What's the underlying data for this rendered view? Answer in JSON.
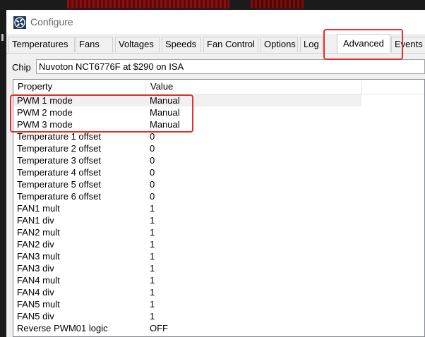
{
  "window": {
    "title": "Configure"
  },
  "tabs": [
    {
      "label": "Temperatures"
    },
    {
      "label": "Fans"
    },
    {
      "label": "Voltages"
    },
    {
      "label": "Speeds"
    },
    {
      "label": "Fan Control"
    },
    {
      "label": "Options"
    },
    {
      "label": "Log"
    },
    {
      "label": "Advanced",
      "active": true
    },
    {
      "label": "Events"
    }
  ],
  "chip": {
    "label": "Chip",
    "value": "Nuvoton NCT6776F at $290 on ISA"
  },
  "table": {
    "headers": [
      "Property",
      "Value"
    ],
    "rows": [
      {
        "property": "PWM 1 mode",
        "value": "Manual",
        "selected": true
      },
      {
        "property": "PWM 2 mode",
        "value": "Manual"
      },
      {
        "property": "PWM 3 mode",
        "value": "Manual"
      },
      {
        "property": "Temperature 1 offset",
        "value": "0"
      },
      {
        "property": "Temperature 2 offset",
        "value": "0"
      },
      {
        "property": "Temperature 3 offset",
        "value": "0"
      },
      {
        "property": "Temperature 4 offset",
        "value": "0"
      },
      {
        "property": "Temperature 5 offset",
        "value": "0"
      },
      {
        "property": "Temperature 6 offset",
        "value": "0"
      },
      {
        "property": "FAN1 mult",
        "value": "1"
      },
      {
        "property": "FAN1 div",
        "value": "1"
      },
      {
        "property": "FAN2 mult",
        "value": "1"
      },
      {
        "property": "FAN2 div",
        "value": "1"
      },
      {
        "property": "FAN3 mult",
        "value": "1"
      },
      {
        "property": "FAN3 div",
        "value": "1"
      },
      {
        "property": "FAN4 mult",
        "value": "1"
      },
      {
        "property": "FAN4 div",
        "value": "1"
      },
      {
        "property": "FAN5 mult",
        "value": "1"
      },
      {
        "property": "FAN5 div",
        "value": "1"
      },
      {
        "property": "Reverse PWM01 logic",
        "value": "OFF"
      }
    ]
  },
  "colors": {
    "highlight": "#e0302e",
    "selected_row": "#f0f0f0"
  },
  "icons": {
    "app": "fan-icon"
  }
}
